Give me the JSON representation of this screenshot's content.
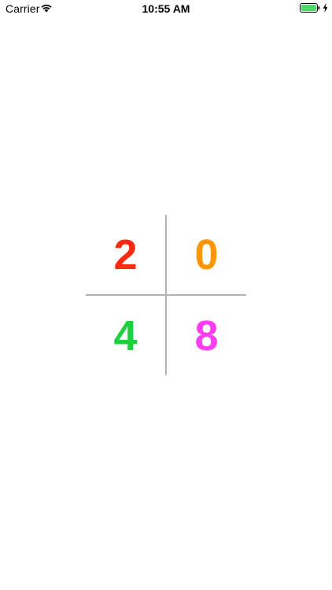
{
  "status_bar": {
    "carrier": "Carrier",
    "time": "10:55 AM",
    "icons": [
      "wifi-icon",
      "battery-icon",
      "charging-icon"
    ],
    "battery_color": "#4cd964"
  },
  "grid": {
    "divider_color": "#b3b3b3",
    "cells": [
      {
        "value": "2",
        "color": "#ff2a10"
      },
      {
        "value": "0",
        "color": "#ff9500"
      },
      {
        "value": "4",
        "color": "#1fce3c"
      },
      {
        "value": "8",
        "color": "#ff3df2"
      }
    ]
  }
}
